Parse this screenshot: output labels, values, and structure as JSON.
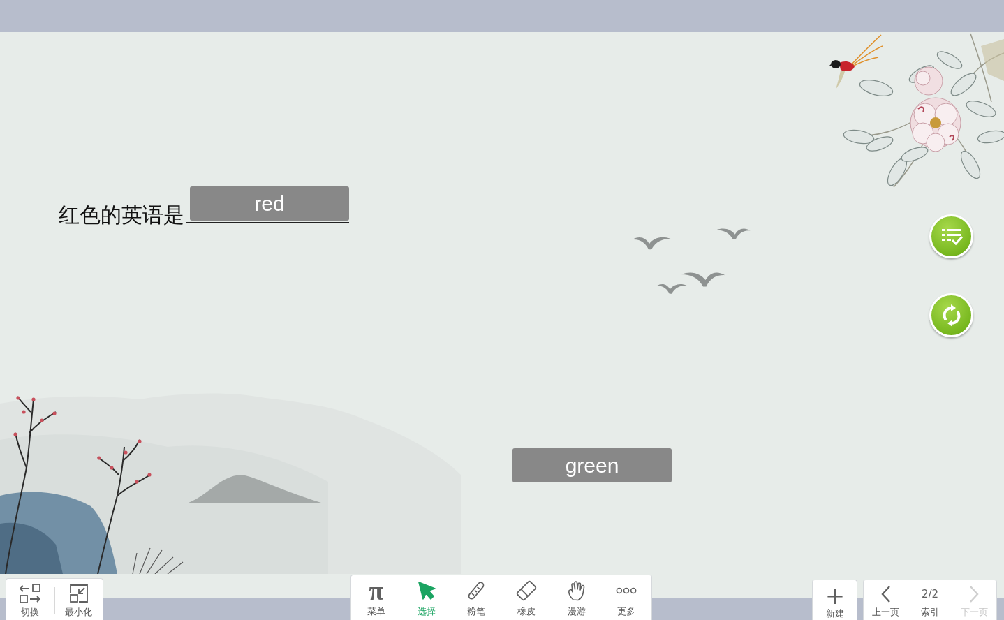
{
  "question": {
    "prompt": "红色的英语是",
    "filled_answer": "red"
  },
  "option_cards": [
    {
      "label": "green"
    }
  ],
  "left_toolbar": [
    {
      "kind": "switch",
      "label": "切换"
    },
    {
      "kind": "minimize",
      "label": "最小化"
    }
  ],
  "tools": [
    {
      "kind": "menu",
      "symbol": "π",
      "label": "菜单",
      "selected": false
    },
    {
      "kind": "select",
      "label": "选择",
      "selected": true
    },
    {
      "kind": "chalk",
      "label": "粉笔",
      "selected": false
    },
    {
      "kind": "eraser",
      "label": "橡皮",
      "selected": false
    },
    {
      "kind": "pan",
      "label": "漫游",
      "selected": false
    },
    {
      "kind": "more",
      "label": "更多",
      "selected": false
    }
  ],
  "new_button": {
    "label": "新建"
  },
  "pager": [
    {
      "kind": "prev",
      "label": "上一页",
      "disabled": false
    },
    {
      "kind": "index",
      "value": "2/2",
      "label": "索引",
      "disabled": false
    },
    {
      "kind": "next",
      "label": "下一页",
      "disabled": true
    }
  ]
}
